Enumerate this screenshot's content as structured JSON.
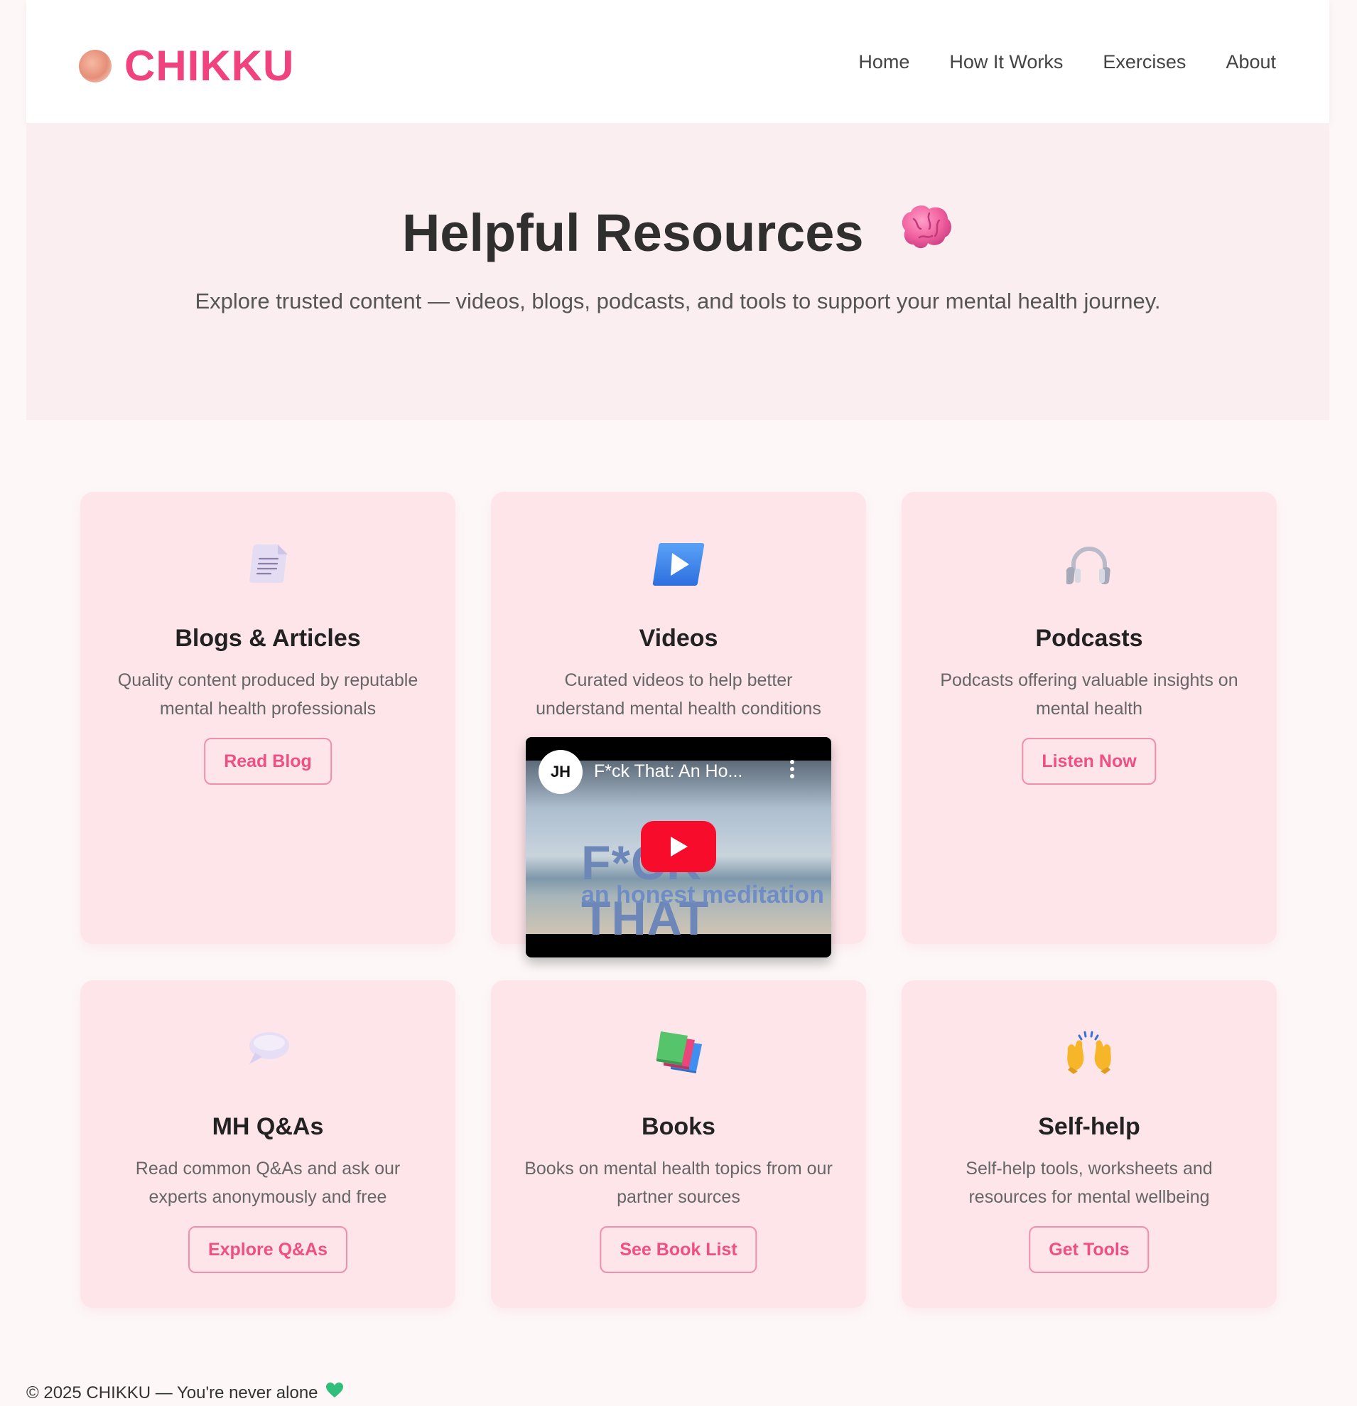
{
  "header": {
    "brand": "CHIKKU",
    "nav": [
      "Home",
      "How It Works",
      "Exercises",
      "About"
    ]
  },
  "hero": {
    "title": "Helpful Resources",
    "subtitle": "Explore trusted content — videos, blogs, podcasts, and tools to support your mental health journey."
  },
  "cards": [
    {
      "title": "Blogs & Articles",
      "description": "Quality content produced by reputable mental health professionals",
      "button": "Read Blog",
      "icon": "document-icon"
    },
    {
      "title": "Videos",
      "description": "Curated videos to help better understand mental health conditions",
      "button": "",
      "icon": "play-icon"
    },
    {
      "title": "Podcasts",
      "description": "Podcasts offering valuable insights on mental health",
      "button": "Listen Now",
      "icon": "headphones-icon"
    },
    {
      "title": "MH Q&As",
      "description": "Read common Q&As and ask our experts anonymously and free",
      "button": "Explore Q&As",
      "icon": "speech-bubble-icon"
    },
    {
      "title": "Books",
      "description": "Books on mental health topics from our partner sources",
      "button": "See Book List",
      "icon": "books-icon"
    },
    {
      "title": "Self-help",
      "description": "Self-help tools, worksheets and resources for mental wellbeing",
      "button": "Get Tools",
      "icon": "raised-hands-icon"
    }
  ],
  "video": {
    "channel_initials": "JH",
    "title": "F*ck That: An Ho...",
    "thumb_big": "F*CK THAT",
    "thumb_small": "an honest meditation"
  },
  "footer": {
    "text": "© 2025 CHIKKU — You're never alone"
  },
  "colors": {
    "brand": "#f0427c",
    "card_bg": "#fde5ea",
    "hero_bg": "#fbeef0",
    "button_border": "#f08fab"
  }
}
